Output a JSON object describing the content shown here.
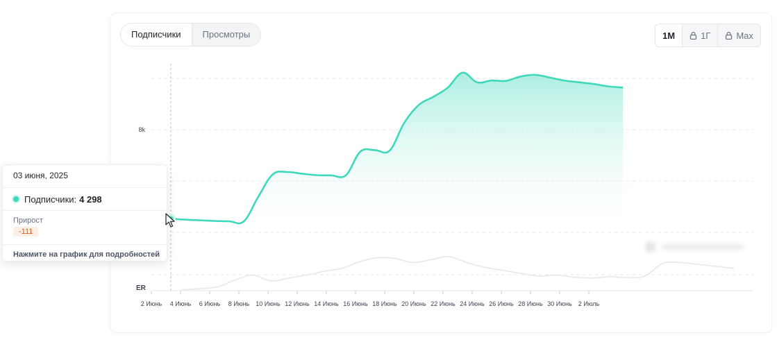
{
  "tabs": [
    {
      "label": "Подписчики",
      "active": true
    },
    {
      "label": "Просмотры",
      "active": false
    }
  ],
  "ranges": [
    {
      "label": "1M",
      "active": true,
      "icon": ""
    },
    {
      "label": "1Г",
      "active": false,
      "icon": "lock-icon"
    },
    {
      "label": "Max",
      "active": false,
      "icon": "lock-icon"
    }
  ],
  "tooltip": {
    "date": "03 июня, 2025",
    "series_label": "Подписчики:",
    "series_value": "4 298",
    "growth_label": "Прирост",
    "growth_value": "-111",
    "hint": "Нажмите на график для подробностей"
  },
  "colors": {
    "main_line": "#3ed8bb",
    "area_top": "#8fe9d6",
    "er_line": "#e7e8ea",
    "growth_badge_bg": "#fbefe6",
    "growth_badge_text": "#d25a1e"
  },
  "chart_data": {
    "type": "area",
    "ylabel": "",
    "y_ticks": [
      {
        "value": 8000,
        "label": "8k"
      }
    ],
    "er_label": "ER",
    "ylim": [
      3800,
      9400
    ],
    "x_tick_labels": [
      "2 Июнь",
      "4 Июнь",
      "6 Июнь",
      "8 Июнь",
      "10 Июнь",
      "12 Июнь",
      "14 Июнь",
      "16 Июнь",
      "18 Июнь",
      "20 Июнь",
      "22 Июнь",
      "24 Июнь",
      "26 Июнь",
      "28 Июнь",
      "30 Июнь",
      "2 Июль"
    ],
    "highlight_index": 1,
    "series": [
      {
        "name": "Подписчики",
        "x": [
          "01.06",
          "02.06",
          "03.06",
          "04.06",
          "05.06",
          "06.06",
          "07.06",
          "08.06",
          "09.06",
          "10.06",
          "11.06",
          "12.06",
          "13.06",
          "14.06",
          "15.06",
          "16.06",
          "17.06",
          "18.06",
          "19.06",
          "20.06",
          "21.06",
          "22.06",
          "23.06",
          "24.06",
          "25.06",
          "26.06",
          "27.06",
          "28.06",
          "29.06",
          "30.06",
          "01.07",
          "02.07",
          "03.07"
        ],
        "values": [
          4350,
          4298,
          4262,
          4238,
          4218,
          4205,
          4200,
          5050,
          5820,
          5898,
          5840,
          5790,
          5782,
          5785,
          6600,
          6650,
          6630,
          7580,
          8200,
          8480,
          8800,
          9310,
          8980,
          9040,
          9030,
          9180,
          9235,
          9140,
          9040,
          8980,
          8920,
          8840,
          8800
        ]
      },
      {
        "name": "ER",
        "x": [
          "01.06",
          "02.06",
          "03.06",
          "04.06",
          "05.06",
          "06.06",
          "07.06",
          "08.06",
          "09.06",
          "10.06",
          "11.06",
          "12.06",
          "13.06",
          "14.06",
          "15.06",
          "16.06",
          "17.06",
          "18.06",
          "19.06",
          "20.06",
          "21.06",
          "22.06",
          "23.06",
          "24.06",
          "25.06",
          "26.06",
          "27.06",
          "28.06",
          "29.06",
          "30.06",
          "01.07",
          "02.07"
        ],
        "values": [
          0.05,
          0.1,
          0.2,
          0.55,
          0.8,
          0.5,
          0.65,
          0.8,
          1.0,
          1.15,
          1.5,
          1.7,
          1.65,
          1.45,
          1.6,
          1.75,
          1.45,
          1.2,
          1.05,
          0.9,
          0.75,
          0.8,
          0.7,
          0.65,
          0.72,
          0.68,
          0.75,
          1.4,
          1.45,
          1.35,
          1.25,
          1.15
        ]
      }
    ]
  }
}
